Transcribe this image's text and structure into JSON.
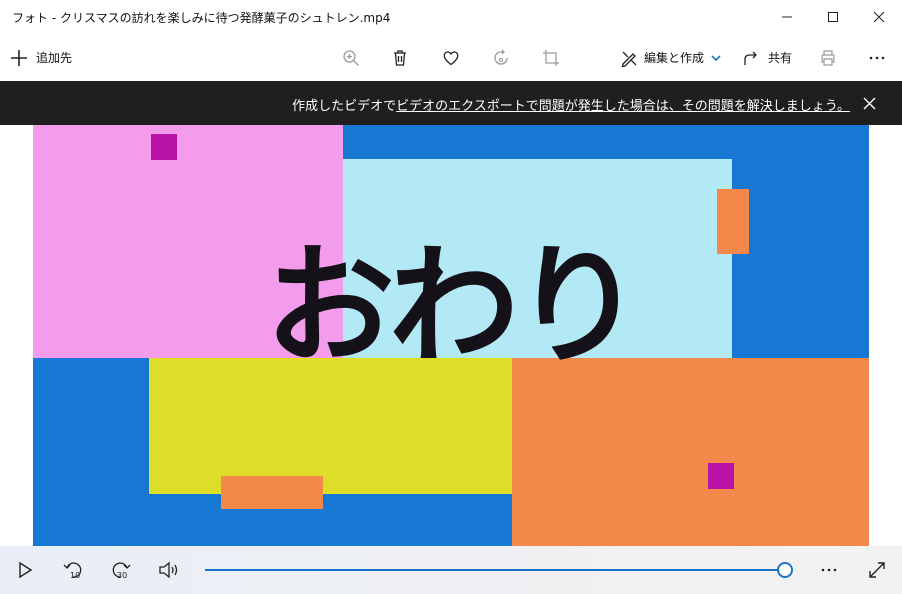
{
  "window": {
    "title": "フォト - クリスマスの訪れを楽しみに待つ発酵菓子のシュトレン.mp4"
  },
  "toolbar": {
    "add_label": "追加先",
    "edit_label": "編集と作成",
    "share_label": "共有"
  },
  "notification": {
    "prefix": "作成したビデオで",
    "link": "ビデオのエクスポートで問題が発生した場合は、その問題を解決しましょう。"
  },
  "video": {
    "caption": "おわり",
    "colors": {
      "background": "#1778d3",
      "pink": "#f29ceb",
      "light_blue": "#b3e9f4",
      "yellow": "#dedd28",
      "orange": "#f3884b",
      "magenta": "#b813a6"
    }
  },
  "player": {
    "progress": 1.0,
    "accent": "#1a73c7"
  }
}
